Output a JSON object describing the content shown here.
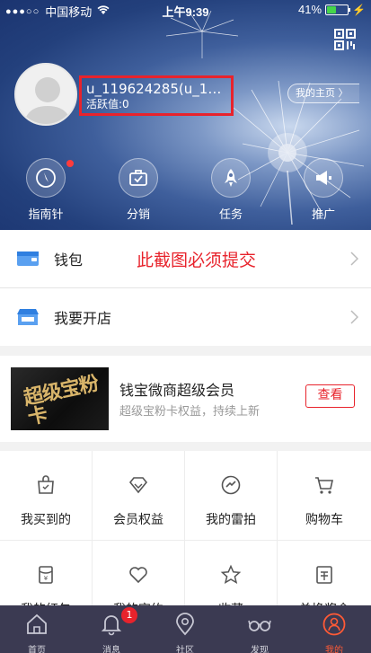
{
  "status_bar": {
    "carrier": "中国移动",
    "time": "上午9:39",
    "battery": "41%",
    "battery_level": 0.41
  },
  "profile": {
    "username": "u_119624285(u_119...",
    "activity": "活跃值:0",
    "homepage_link": "我的主页 〉"
  },
  "header_nav": [
    {
      "label": "指南针",
      "icon": "compass-icon",
      "has_dot": true
    },
    {
      "label": "分销",
      "icon": "briefcase-icon"
    },
    {
      "label": "任务",
      "icon": "rocket-icon"
    },
    {
      "label": "推广",
      "icon": "megaphone-icon"
    }
  ],
  "menu": {
    "wallet_label": "钱包",
    "open_shop_label": "我要开店",
    "notice_text": "此截图必须提交"
  },
  "promo": {
    "image_text": "超级宝粉卡",
    "title": "钱宝微商超级会员",
    "subtitle": "超级宝粉卡权益，持续上新",
    "button_label": "查看"
  },
  "grid": [
    {
      "label": "我买到的",
      "icon": "shopping-bag-icon"
    },
    {
      "label": "会员权益",
      "icon": "diamond-icon"
    },
    {
      "label": "我的雷拍",
      "icon": "auction-icon"
    },
    {
      "label": "购物车",
      "icon": "cart-icon"
    },
    {
      "label": "我的红包",
      "icon": "red-envelope-icon"
    },
    {
      "label": "我的宝约",
      "icon": "heart-chat-icon"
    },
    {
      "label": "收藏",
      "icon": "star-icon"
    },
    {
      "label": "兑换奖金",
      "icon": "exchange-icon"
    }
  ],
  "tabbar": [
    {
      "label": "首页",
      "icon": "home-icon"
    },
    {
      "label": "消息",
      "icon": "bell-icon",
      "badge": "1"
    },
    {
      "label": "社区",
      "icon": "location-icon"
    },
    {
      "label": "发现",
      "icon": "glasses-icon"
    },
    {
      "label": "我的",
      "icon": "user-icon",
      "active": true
    }
  ],
  "colors": {
    "accent": "#e8232c",
    "header_blue": "#23407c",
    "tabbar": "#3b3a52",
    "active_tab": "#ff5a36"
  }
}
